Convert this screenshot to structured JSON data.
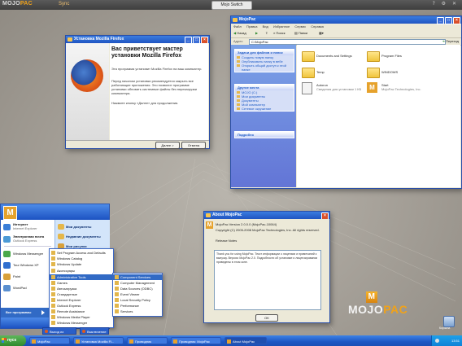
{
  "topbar": {
    "brand_a": "MOJO",
    "brand_b": "PAC",
    "menu": "Sync",
    "center_tab": "Mojo Switch",
    "icons": "? ⚙ ✕"
  },
  "firefox_setup": {
    "title": "Установка Mozilla Firefox",
    "heading": "Вас приветствует мастер установки Mozilla Firefox",
    "p1": "Эта программа установит Mozilla Firefox на ваш компьютер.",
    "p2": "Перед началом установки рекомендуется закрыть все работающие приложения. Это позволит программе установки обновить системные файлы без перезагрузки компьютера.",
    "p3": "Нажмите кнопку «Далее» для продолжения.",
    "next": "Далее >",
    "cancel": "Отмена"
  },
  "explorer": {
    "title": "MojoPac",
    "menu": [
      "Файл",
      "Правка",
      "Вид",
      "Избранное",
      "Сервис",
      "Справка"
    ],
    "back": "Назад",
    "search": "Поиск",
    "folders": "Папки",
    "address_label": "Адрес",
    "address": "C:\\MojoPac",
    "go": "Переход",
    "panel1_title": "Задачи для файлов и папок",
    "panel1_items": [
      "Создать новую папку",
      "Опубликовать папку в вебе",
      "Открыть общий доступ к этой папке"
    ],
    "panel2_title": "Другие места",
    "panel2_items": [
      "MOJO (C:)",
      "Мои документы",
      "Документы",
      "Мой компьютер",
      "Сетевое окружение"
    ],
    "panel3_title": "Подробно",
    "files": [
      {
        "name": "Documents and Settings"
      },
      {
        "name": "Program Files"
      },
      {
        "name": "Temp"
      },
      {
        "name": "WINDOWS"
      },
      {
        "name": "Autorun",
        "sub": "Сведения для установки 1 КБ"
      },
      {
        "name": "Start",
        "sub": "MojoPac Technologies, Inc."
      }
    ]
  },
  "about": {
    "title": "About MojoPac",
    "version": "MojoPac Version 2.0.0.0 (MojoPac-10064)",
    "copyright": "Copyright (C) 2005-2008 MojoPac Technologies, Inc. All rights reserved.",
    "label": "Release Notes",
    "text": "Thank you for using MojoPac. Текст информации о лицензии и примечаний к выпуску. Версия: MojoPac 2.0. Подробности об установке и лицензировании приведены в этом окне.",
    "ok": "OK"
  },
  "startmenu": {
    "left_items": [
      {
        "label": "Интернет",
        "sub": "Internet Explorer"
      },
      {
        "label": "Электронная почта",
        "sub": "Outlook Express"
      },
      {
        "label": "Windows Messenger",
        "sub": ""
      },
      {
        "label": "Tour Windows XP",
        "sub": ""
      },
      {
        "label": "Paint",
        "sub": ""
      },
      {
        "label": "WordPad",
        "sub": ""
      }
    ],
    "all_programs": "Все программы",
    "right_items": [
      "Мои документы",
      "Недавние документы",
      "Мои рисунки"
    ],
    "programs_menu": [
      "Set Program Access and Defaults",
      "Windows Catalog",
      "Windows Update",
      "Аксессуары",
      "Administrative Tools",
      "Games",
      "Автозагрузка",
      "Стандартные",
      "Internet Explorer",
      "Outlook Express",
      "Remote Assistance",
      "Windows Media Player",
      "Windows Messenger"
    ],
    "admin_menu": [
      "Component Services",
      "Computer Management",
      "Data Sources (ODBC)",
      "Event Viewer",
      "Local Security Policy",
      "Performance",
      "Services"
    ],
    "logoff": "Выход из системы",
    "shutdown": "Выключение"
  },
  "taskbar": {
    "start": "пуск",
    "tasks": [
      "MojoPac",
      "Установка Mozilla Fi...",
      "Проводник",
      "Проводник: MojoPac",
      "About MojoPac"
    ],
    "clock": "13:51"
  },
  "desktop": {
    "logo_a": "MOJO",
    "logo_b": "PAC",
    "logo_m": "M",
    "recycle": "Корзина"
  },
  "colors": {
    "titlebar": "#1f55c2",
    "brand_accent": "#f0a21a",
    "start_green": "#2f8a2c"
  }
}
